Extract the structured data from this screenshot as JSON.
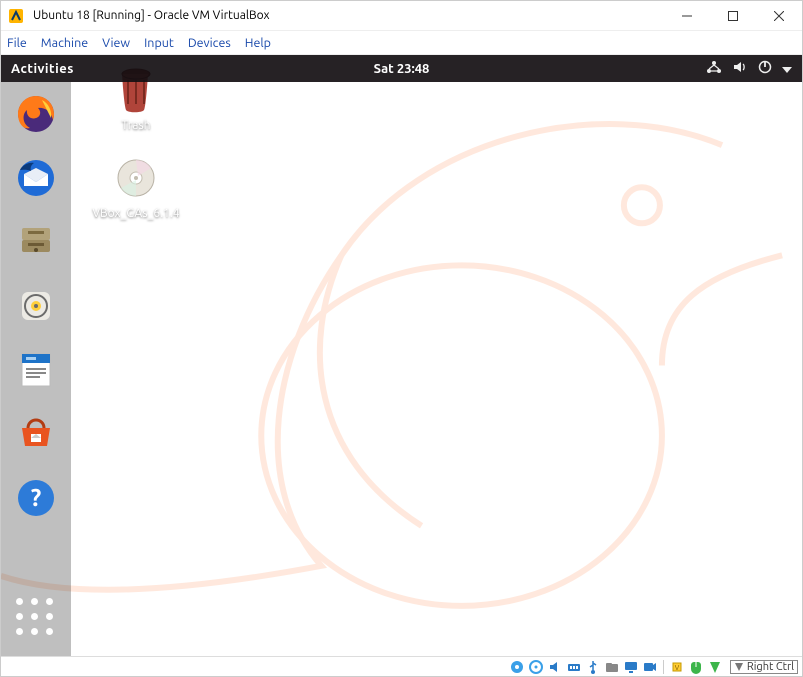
{
  "host_window": {
    "title": "Ubuntu 18 [Running] - Oracle VM VirtualBox",
    "menu": [
      "File",
      "Machine",
      "View",
      "Input",
      "Devices",
      "Help"
    ]
  },
  "gnome_topbar": {
    "activities": "Activities",
    "clock": "Sat 23:48",
    "indicators": [
      "network-icon",
      "sound-icon",
      "power-icon",
      "dropdown-caret"
    ]
  },
  "dock": {
    "items": [
      {
        "name": "firefox-icon"
      },
      {
        "name": "thunderbird-icon"
      },
      {
        "name": "files-icon"
      },
      {
        "name": "rhythmbox-icon"
      },
      {
        "name": "writer-icon"
      },
      {
        "name": "software-icon"
      },
      {
        "name": "help-icon"
      }
    ],
    "show_applications": "show-applications"
  },
  "desktop_icons": [
    {
      "name": "trash",
      "label": "Trash"
    },
    {
      "name": "cdrom",
      "label": "VBox_GAs_6.1.4"
    }
  ],
  "vbox_statusbar": {
    "icons": [
      "hard-disk-icon",
      "optical-disk-icon",
      "audio-icon",
      "network-adapter-icon",
      "usb-icon",
      "shared-folder-icon",
      "display-icon",
      "recording-icon",
      "cpu-icon",
      "mouse-integration-icon",
      "keyboard-icon"
    ],
    "host_key": "Right Ctrl"
  }
}
